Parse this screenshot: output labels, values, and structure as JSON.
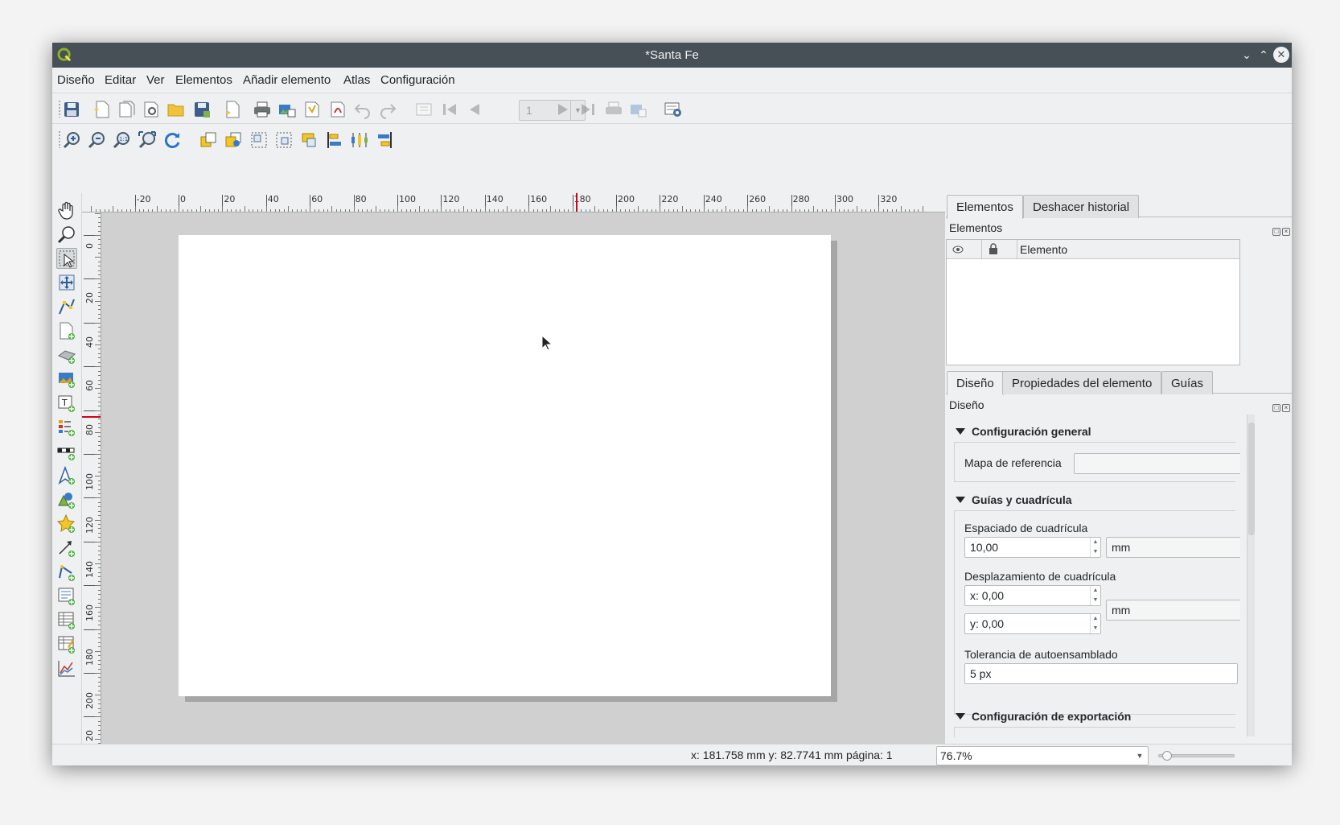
{
  "window": {
    "title": "*Santa Fe"
  },
  "menu": [
    "Diseño",
    "Editar",
    "Ver",
    "Elementos",
    "Añadir elemento",
    "Atlas",
    "Configuración"
  ],
  "atlas_toolbar": {
    "page_value": "1"
  },
  "ruler_top_ticks": [
    "-20",
    "0",
    "20",
    "40",
    "60",
    "80",
    "100",
    "120",
    "140",
    "160",
    "180",
    "200",
    "220",
    "240",
    "260",
    "280",
    "300",
    "320"
  ],
  "ruler_left_ticks": [
    "0",
    "20",
    "40",
    "60",
    "80",
    "100",
    "120",
    "140",
    "160",
    "180",
    "200",
    "20"
  ],
  "dock_top": {
    "tabs": [
      "Elementos",
      "Deshacer historial"
    ],
    "title": "Elementos",
    "column_header": "Elemento"
  },
  "dock_bottom": {
    "tabs": [
      "Diseño",
      "Propiedades del elemento",
      "Guías"
    ],
    "title": "Diseño",
    "general": {
      "header": "Configuración general",
      "reference_map_label": "Mapa de referencia",
      "reference_map_value": ""
    },
    "guides": {
      "header": "Guías y cuadrícula",
      "spacing_label": "Espaciado de cuadrícula",
      "spacing_value": "10,00",
      "spacing_unit": "mm",
      "offset_label": "Desplazamiento de cuadrícula",
      "offset_x": "x: 0,00",
      "offset_y": "y: 0,00",
      "offset_unit": "mm",
      "snap_label": "Tolerancia de autoensamblado",
      "snap_value": "5 px"
    },
    "export": {
      "header": "Configuración de exportación"
    }
  },
  "status": {
    "coords": "x: 181.758 mm  y: 82.7741 mm  página: 1",
    "zoom": "76.7%",
    "zoom_slider_fraction": 0.05
  },
  "colors": {
    "titlebar": "#475057",
    "window_bg": "#eff0f1",
    "canvas_bg": "#d0d0d0",
    "ruler_marker": "#d0021b"
  }
}
